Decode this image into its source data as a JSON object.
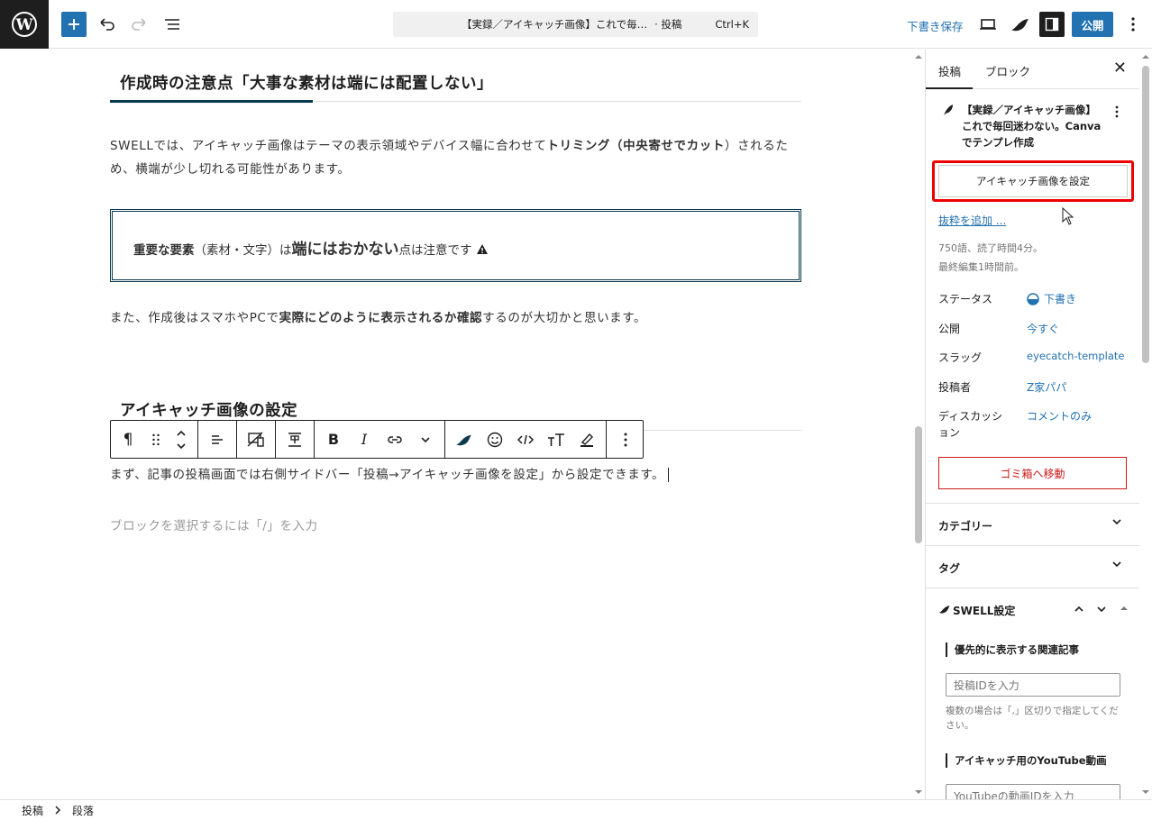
{
  "header": {
    "doc_title": "【実録／アイキャッチ画像】これで毎…",
    "doc_type": "· 投稿",
    "shortcut": "Ctrl+K",
    "save_draft": "下書き保存",
    "publish": "公開"
  },
  "editor": {
    "heading1": "作成時の注意点「大事な素材は端には配置しない」",
    "para1_a": "SWELLでは、アイキャッチ画像はテーマの表示領域やデバイス幅に合わせて",
    "para1_b": "トリミング（中央寄せでカット",
    "para1_c": "）されるため、横端が少し切れる可能性があります。",
    "box_a": "重要な要素",
    "box_b": "（素材・文字）は",
    "box_c": "端にはおかない",
    "box_d": "点は注意です",
    "para2_a": "また、作成後はスマホやPCで",
    "para2_b": "実際にどのように表示されるか確認",
    "para2_c": "するのが大切かと思います。",
    "heading2": "アイキャッチ画像の設定",
    "para3": "まず、記事の投稿画面では右側サイドバー「投稿→アイキャッチ画像を設定」から設定できます。",
    "placeholder": "ブロックを選択するには「/」を入力"
  },
  "sidebar": {
    "tab_post": "投稿",
    "tab_block": "ブロック",
    "post_title": "【実録／アイキャッチ画像】これで毎回迷わない。Canvaでテンプレ作成",
    "featured_btn": "アイキャッチ画像を設定",
    "excerpt": "抜粋を追加 ...",
    "words": "750語、読了時間4分。",
    "last_edit": "最終編集1時間前。",
    "rows": [
      {
        "label": "ステータス",
        "value": "下書き"
      },
      {
        "label": "公開",
        "value": "今すぐ"
      },
      {
        "label": "スラッグ",
        "value": "eyecatch-template"
      },
      {
        "label": "投稿者",
        "value": "Z家パパ"
      },
      {
        "label": "ディスカッション",
        "value": "コメントのみ"
      }
    ],
    "trash": "ゴミ箱へ移動",
    "panel_category": "カテゴリー",
    "panel_tag": "タグ",
    "panel_swell": "SWELL設定",
    "related_label": "優先的に表示する関連記事",
    "related_placeholder": "投稿IDを入力",
    "related_help": "複数の場合は「,」区切りで指定してください。",
    "youtube_label": "アイキャッチ用のYouTube動画",
    "youtube_placeholder": "YouTubeの動画IDを入力"
  },
  "footer": {
    "crumb1": "投稿",
    "crumb2": "段落"
  },
  "colors": {
    "accent": "#2271b1",
    "heading_accent": "#0b3a4e",
    "danger": "#cc1818",
    "highlight": "#ee0000"
  }
}
